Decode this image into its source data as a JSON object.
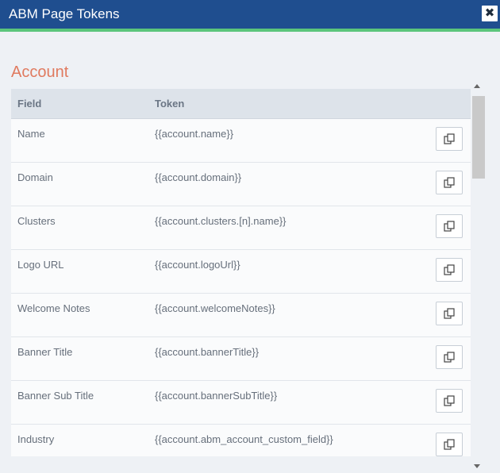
{
  "dialog": {
    "title": "ABM Page Tokens",
    "close_label": "✖"
  },
  "section": {
    "title": "Account"
  },
  "table": {
    "headers": {
      "field": "Field",
      "token": "Token"
    },
    "rows": [
      {
        "field": "Name",
        "token": "{{account.name}}"
      },
      {
        "field": "Domain",
        "token": "{{account.domain}}"
      },
      {
        "field": "Clusters",
        "token": "{{account.clusters.[n].name}}"
      },
      {
        "field": "Logo URL",
        "token": "{{account.logoUrl}}"
      },
      {
        "field": "Welcome Notes",
        "token": "{{account.welcomeNotes}}"
      },
      {
        "field": "Banner Title",
        "token": "{{account.bannerTitle}}"
      },
      {
        "field": "Banner Sub Title",
        "token": "{{account.bannerSubTitle}}"
      },
      {
        "field": "Industry",
        "token": "{{account.abm_account_custom_field}}"
      }
    ]
  },
  "colors": {
    "titlebar": "#1f4e8f",
    "accent": "#5bc57b",
    "section_title": "#e07a5f"
  },
  "icons": {
    "copy": "copy-icon",
    "close": "close-icon",
    "scroll_up": "chevron-up-icon",
    "scroll_down": "chevron-down-icon"
  }
}
